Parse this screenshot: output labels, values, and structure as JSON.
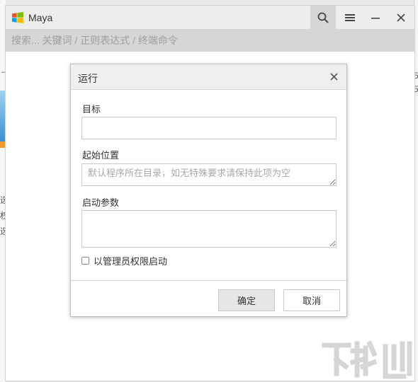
{
  "window": {
    "title": "Maya",
    "search_placeholder": "搜索... 关键词 / 正则表达式 / 终端命令"
  },
  "toolbar": {
    "search": "search-icon",
    "menu": "hamburger-menu-icon",
    "minimize": "minimize-icon",
    "close": "close-icon"
  },
  "dialog": {
    "title": "运行",
    "target_label": "目标",
    "target_value": "",
    "start_dir_label": "起始位置",
    "start_dir_placeholder": "默认程序所在目录，如无特殊要求请保持此项为空",
    "args_label": "启动参数",
    "args_value": "",
    "admin_label": "以管理员权限启动",
    "admin_checked": false,
    "ok_label": "确定",
    "cancel_label": "取消"
  },
  "background": {
    "left_chars": [
      "ㄱ",
      "选",
      "权",
      "选"
    ],
    "right_chars": [
      "5",
      "5"
    ]
  },
  "colors": {
    "titlebar": "#ededed",
    "search_bar": "#d6d6d6",
    "dialog_header": "#efefef",
    "ok_button": "#e6e6e6"
  }
}
